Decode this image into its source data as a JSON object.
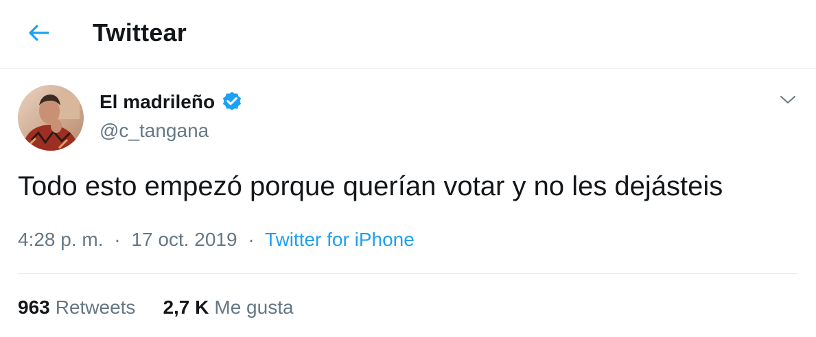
{
  "header": {
    "title": "Twittear",
    "back_icon": "arrow-left-icon"
  },
  "tweet": {
    "author": {
      "display_name": "El madrileño",
      "handle": "@c_tangana",
      "verified": true
    },
    "text": "Todo esto empezó porque querían votar y no les dejásteis",
    "time": "4:28 p. m.",
    "date": "17 oct. 2019",
    "separator": "·",
    "source": "Twitter for iPhone",
    "stats": {
      "retweets_count": "963",
      "retweets_label": "Retweets",
      "likes_count": "2,7 K",
      "likes_label": "Me gusta"
    }
  },
  "colors": {
    "accent": "#1da1f2",
    "text_primary": "#14171a",
    "text_secondary": "#657786",
    "divider": "#e6ecf0"
  }
}
